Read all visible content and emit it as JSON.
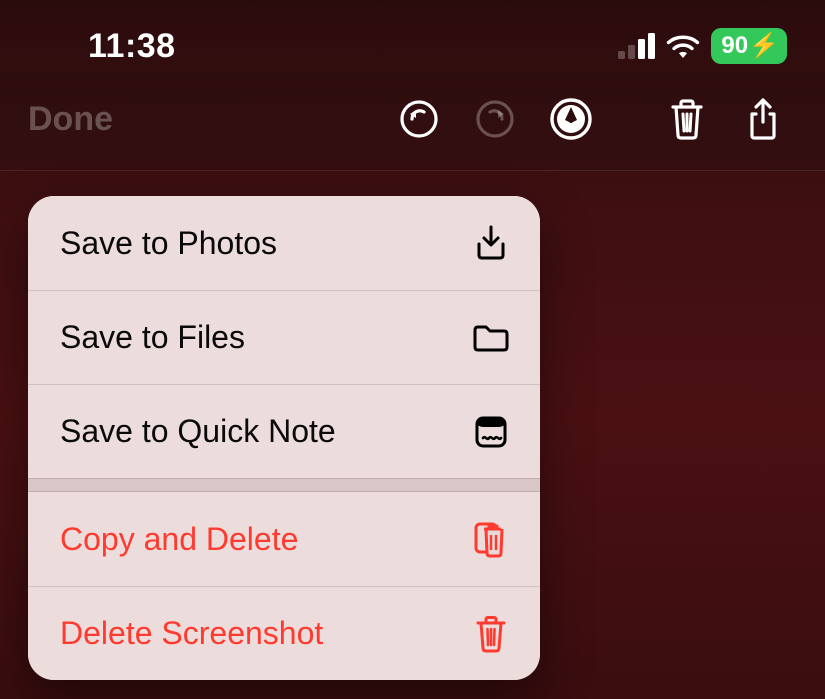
{
  "status": {
    "time": "11:38",
    "battery_pct": "90",
    "battery_charging": true
  },
  "toolbar": {
    "done_label": "Done"
  },
  "menu": {
    "items": [
      {
        "label": "Save to Photos",
        "icon": "download-to-tray-icon",
        "destructive": false
      },
      {
        "label": "Save to Files",
        "icon": "folder-icon",
        "destructive": false
      },
      {
        "label": "Save to Quick Note",
        "icon": "quick-note-icon",
        "destructive": false
      }
    ],
    "destructive_items": [
      {
        "label": "Copy and Delete",
        "icon": "clipboard-trash-icon",
        "destructive": true
      },
      {
        "label": "Delete Screenshot",
        "icon": "trash-icon",
        "destructive": true
      }
    ]
  }
}
